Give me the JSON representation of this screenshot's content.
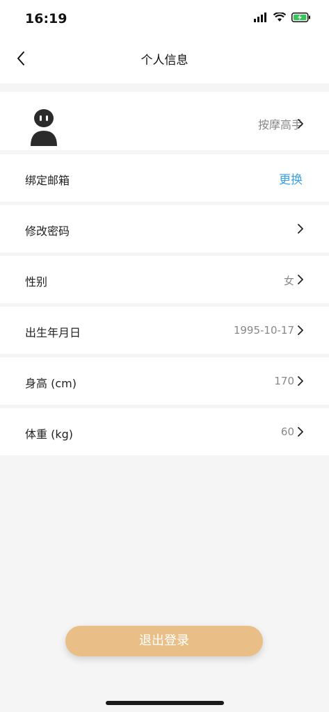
{
  "status_bar": {
    "time": "16:19"
  },
  "navbar": {
    "title": "个人信息"
  },
  "profile": {
    "nickname": "按摩高手"
  },
  "rows": [
    {
      "label": "绑定邮箱",
      "action": "更换"
    },
    {
      "label": "修改密码",
      "value": ""
    },
    {
      "label": "性别",
      "value": "女"
    },
    {
      "label": "出生年月日",
      "value": "1995-10-17"
    },
    {
      "label": "身高 (cm)",
      "value": "170"
    },
    {
      "label": "体重 (kg)",
      "value": "60"
    }
  ],
  "logout_button": {
    "label": "退出登录"
  },
  "colors": {
    "accent": "#3aa0e8",
    "button": "#e9bf87"
  }
}
